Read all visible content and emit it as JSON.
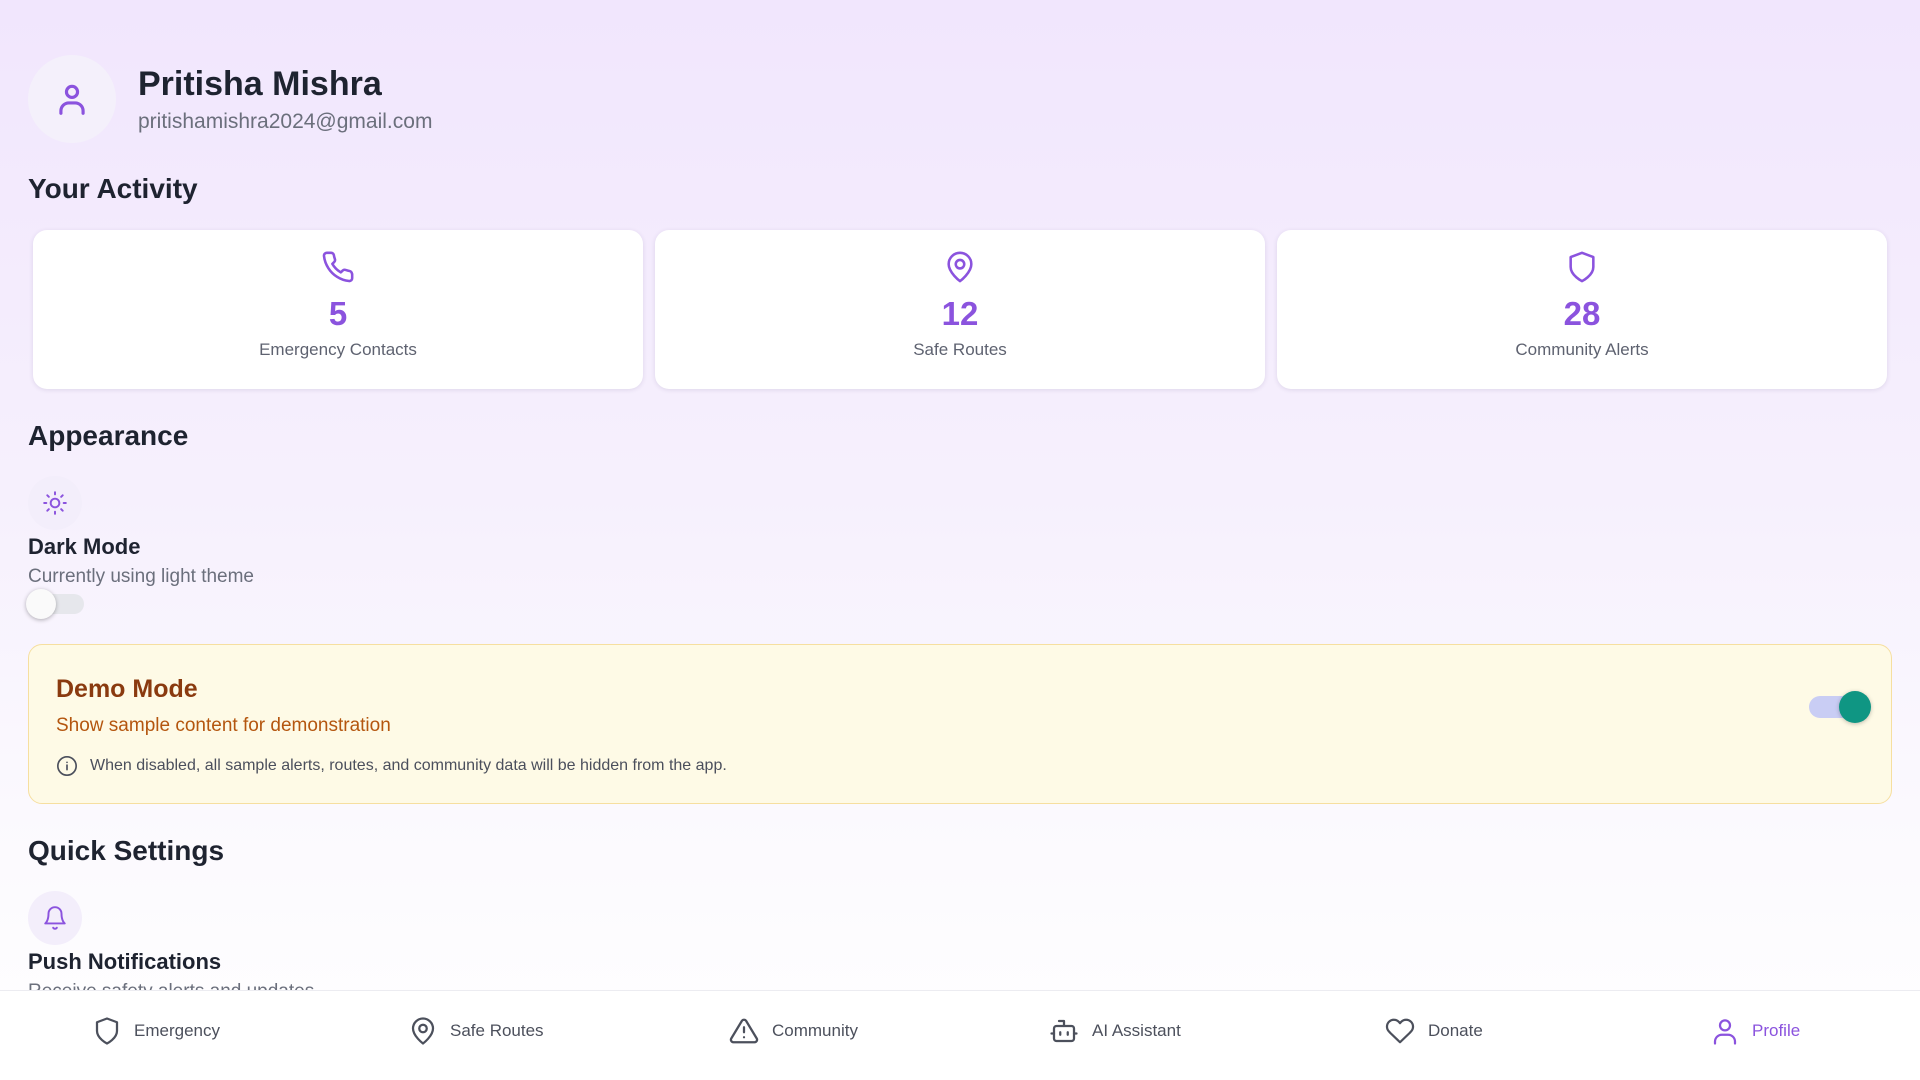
{
  "profile": {
    "name": "Pritisha Mishra",
    "email": "pritishamishra2024@gmail.com"
  },
  "activity": {
    "title": "Your Activity",
    "stats": [
      {
        "icon": "phone-icon",
        "value": "5",
        "label": "Emergency Contacts"
      },
      {
        "icon": "map-pin-icon",
        "value": "12",
        "label": "Safe Routes"
      },
      {
        "icon": "shield-icon",
        "value": "28",
        "label": "Community Alerts"
      }
    ]
  },
  "appearance": {
    "title": "Appearance",
    "dark_mode": {
      "icon": "sun-icon",
      "title": "Dark Mode",
      "subtitle": "Currently using light theme",
      "enabled": false
    }
  },
  "demo_mode": {
    "title": "Demo Mode",
    "subtitle": "Show sample content for demonstration",
    "note": "When disabled, all sample alerts, routes, and community data will be hidden from the app.",
    "enabled": true
  },
  "quick_settings": {
    "title": "Quick Settings",
    "push_notifications": {
      "icon": "bell-icon",
      "title": "Push Notifications",
      "subtitle": "Receive safety alerts and updates"
    }
  },
  "nav": {
    "items": [
      {
        "icon": "shield-icon",
        "label": "Emergency",
        "active": false
      },
      {
        "icon": "map-pin-icon",
        "label": "Safe Routes",
        "active": false
      },
      {
        "icon": "alert-triangle-icon",
        "label": "Community",
        "active": false
      },
      {
        "icon": "robot-icon",
        "label": "AI Assistant",
        "active": false
      },
      {
        "icon": "heart-icon",
        "label": "Donate",
        "active": false
      },
      {
        "icon": "user-icon",
        "label": "Profile",
        "active": true
      }
    ]
  },
  "colors": {
    "accent": "#8b53de",
    "demo_title": "#8a3a0f",
    "demo_subtitle": "#b4560f",
    "toggle_on": "#0f9683"
  }
}
